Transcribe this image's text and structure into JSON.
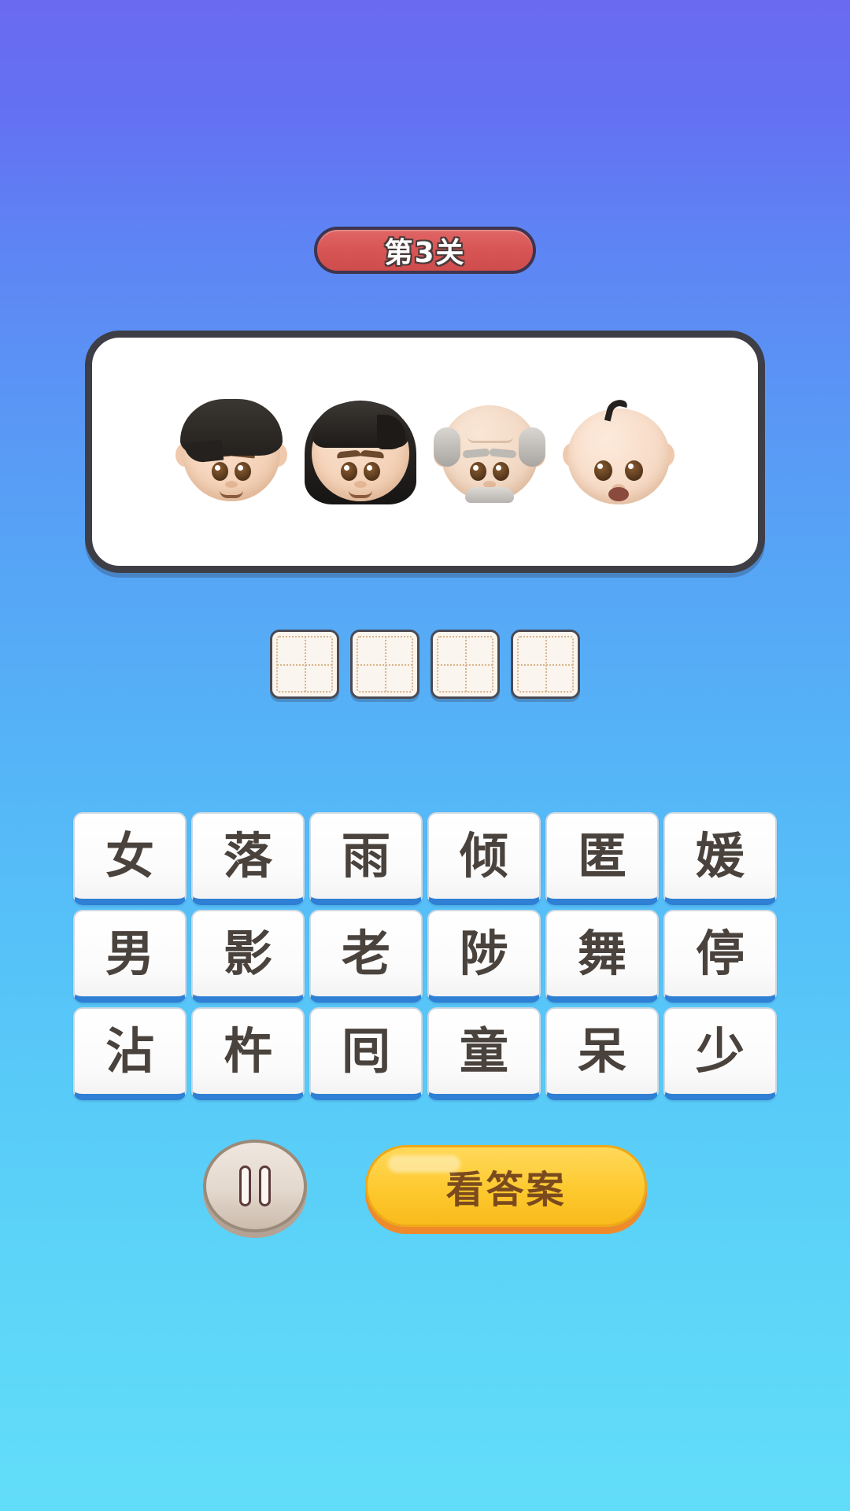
{
  "level_badge": {
    "label": "第3关"
  },
  "puzzle": {
    "emojis": [
      {
        "name": "boy-face-emoji",
        "glyph": "👦",
        "description": "boy"
      },
      {
        "name": "woman-face-emoji",
        "glyph": "👩",
        "description": "woman"
      },
      {
        "name": "old-man-face-emoji",
        "glyph": "👴",
        "description": "older man"
      },
      {
        "name": "baby-face-emoji",
        "glyph": "👶",
        "description": "baby"
      }
    ]
  },
  "answer_slots": {
    "count": 4,
    "values": [
      "",
      "",
      "",
      ""
    ]
  },
  "tile_grid": {
    "rows": [
      [
        "女",
        "落",
        "雨",
        "倾",
        "匿",
        "媛"
      ],
      [
        "男",
        "影",
        "老",
        "陟",
        "舞",
        "停"
      ],
      [
        "沾",
        "杵",
        "囘",
        "童",
        "呆",
        "少"
      ]
    ]
  },
  "bottom_bar": {
    "pause_label": "",
    "answer_label": "看答案"
  },
  "colors": {
    "background_top": "#6a6af0",
    "background_bottom": "#62ddf9",
    "badge_fill": "#d95656",
    "badge_border": "#3d3550",
    "panel_border": "#3e3e46",
    "tile_bottom": "#2f7fd4",
    "answer_button": "#fdc92f",
    "answer_button_shadow": "#ef8a2a",
    "answer_text": "#7a4a1e",
    "pause_button": "#e3d8cd",
    "slot_fill": "#faf5ee",
    "slot_grid": "#d9b48a"
  }
}
